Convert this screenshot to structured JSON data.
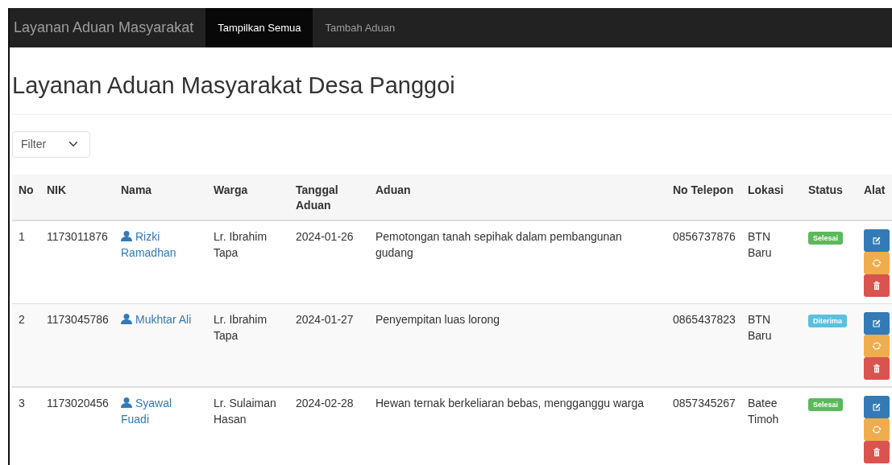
{
  "navbar": {
    "brand": "Layanan Aduan Masyarakat",
    "items": [
      {
        "label": "Tampilkan Semua",
        "selected": true
      },
      {
        "label": "Tambah Aduan",
        "selected": false
      }
    ]
  },
  "heading": "Layanan Aduan Masyarakat Desa Panggoi",
  "filter": {
    "value": "Filter"
  },
  "table": {
    "columns": [
      "No",
      "NIK",
      "Nama",
      "Warga",
      "Tanggal Aduan",
      "Aduan",
      "No Telepon",
      "Lokasi",
      "Status",
      "Alat"
    ],
    "rows": [
      {
        "no": "1",
        "nik": "1173011876",
        "nama": "Rizki Ramadhan",
        "warga": "Lr. Ibrahim Tapa",
        "tanggal": "2024-01-26",
        "aduan": "Pemotongan tanah sepihak dalam pembangunan gudang",
        "telepon": "0856737876",
        "lokasi": "BTN Baru",
        "status": {
          "label": "Selesai",
          "kind": "success"
        }
      },
      {
        "no": "2",
        "nik": "1173045786",
        "nama": "Mukhtar Ali",
        "warga": "Lr. Ibrahim Tapa",
        "tanggal": "2024-01-27",
        "aduan": "Penyempitan luas lorong",
        "telepon": "0865437823",
        "lokasi": "BTN Baru",
        "status": {
          "label": "Diterima",
          "kind": "info"
        }
      },
      {
        "no": "3",
        "nik": "1173020456",
        "nama": "Syawal Fuadi",
        "warga": "Lr. Sulaiman Hasan",
        "tanggal": "2024-02-28",
        "aduan": "Hewan ternak berkeliaran bebas, mengganggu warga",
        "telepon": "0857345267",
        "lokasi": "Batee Timoh",
        "status": {
          "label": "Selesai",
          "kind": "success"
        }
      }
    ]
  }
}
